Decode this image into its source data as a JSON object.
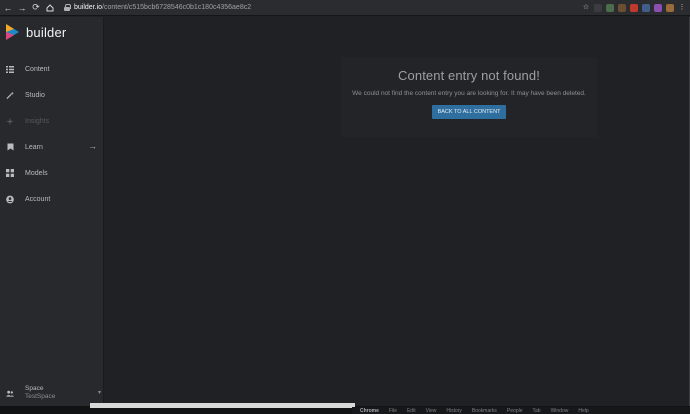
{
  "browser": {
    "url_host": "builder.io",
    "url_path": "/content/c515bcb6728546c0b1c180c4356ae8c2"
  },
  "sidebar": {
    "logo_text": "builder",
    "items": [
      {
        "label": "Content",
        "icon": "list-icon"
      },
      {
        "label": "Studio",
        "icon": "magic-wand-icon"
      },
      {
        "label": "Insights",
        "icon": "sparkle-icon",
        "disabled": true
      },
      {
        "label": "Learn",
        "icon": "bookmark-icon",
        "arrow": "→"
      },
      {
        "label": "Models",
        "icon": "grid-icon"
      },
      {
        "label": "Account",
        "icon": "account-circle-icon"
      }
    ],
    "space": {
      "label": "Space",
      "name": "TestSpace",
      "icon": "people-icon"
    }
  },
  "main": {
    "title": "Content entry not found!",
    "message": "We could not find the content entry you are looking for. It may have been deleted.",
    "button_label": "BACK TO ALL CONTENT"
  },
  "menubar": {
    "items": [
      "Chrome",
      "File",
      "Edit",
      "View",
      "History",
      "Bookmarks",
      "People",
      "Tab",
      "Window",
      "Help"
    ]
  },
  "colors": {
    "accent": "#2f6f9f",
    "sidebar_bg": "#27292c",
    "main_bg": "#1f2124"
  }
}
